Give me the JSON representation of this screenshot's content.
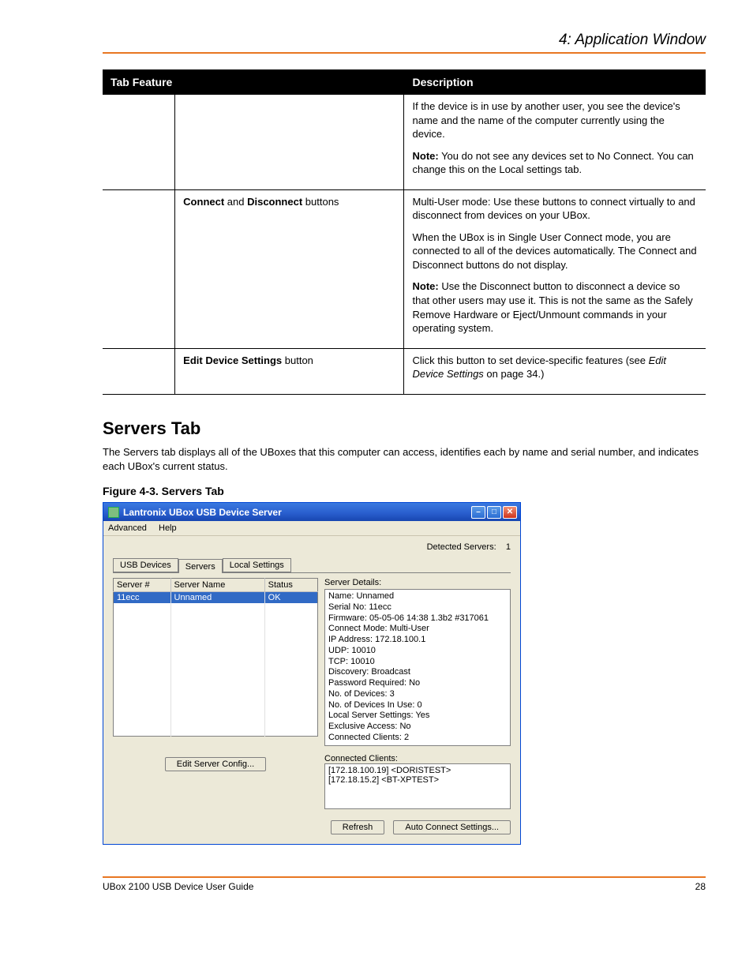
{
  "doc": {
    "header_right": "4: Application Window",
    "footer_left": "UBox 2100 USB Device User Guide",
    "footer_right": "28"
  },
  "table": {
    "h1": "Tab Feature",
    "h2": "Description",
    "rows": [
      {
        "c1": "",
        "c2_paras": [
          ""
        ],
        "c3_paras": [
          "If the device is in use by another user, you see the device's name and the name of the computer currently using the device.",
          "<strong>Note:</strong> You do not see any devices set to No Connect. You can change this on the Local settings tab."
        ]
      },
      {
        "c1": "",
        "c2_paras": [
          "<strong>Connect</strong> and <strong>Disconnect</strong> buttons"
        ],
        "c3_paras": [
          "Multi-User mode: Use these buttons to connect virtually to and disconnect from devices on your UBox.",
          "When the UBox is in Single User Connect mode, you are connected to all of the devices automatically. The Connect and Disconnect buttons do not display.",
          "<strong>Note:</strong> Use the Disconnect button to disconnect a device so that other users may use it. This is not the same as the Safely Remove Hardware or Eject/Unmount commands in your operating system."
        ]
      },
      {
        "c1": "",
        "c2_paras": [
          "<strong>Edit Device Settings</strong> button"
        ],
        "c3_paras": [
          "Click this button to set device-specific features (see <em>Edit Device Settings</em> on page 34.)"
        ]
      }
    ]
  },
  "section": {
    "title": "Servers Tab",
    "body": "The Servers tab displays all of the UBoxes that this computer can access, identifies each by name and serial number, and indicates each UBox's current status.",
    "figcap": "Figure 4-3. Servers Tab"
  },
  "win": {
    "title": "Lantronix UBox USB Device Server",
    "menu": {
      "advanced": "Advanced",
      "help": "Help"
    },
    "detected_label": "Detected Servers:",
    "detected_count": "1",
    "tabs": {
      "usb": "USB Devices",
      "servers": "Servers",
      "local": "Local Settings"
    },
    "cols": {
      "num": "Server #",
      "name": "Server Name",
      "status": "Status"
    },
    "rows": [
      {
        "num": "11ecc",
        "name": "Unnamed",
        "status": "OK"
      }
    ],
    "edit_btn": "Edit Server Config...",
    "details_label": "Server Details:",
    "details": {
      "Name": "Unnamed",
      "Serial_No": "11ecc",
      "Firmware": "05-05-06 14:38 1.3b2 #317061",
      "Connect_Mode": "Multi-User",
      "IP_Address": "172.18.100.1",
      "UDP": "10010",
      "TCP": "10010",
      "Discovery": "Broadcast",
      "Password_Required": "No",
      "No_of_Devices": "3",
      "No_of_Devices_In_Use": "0",
      "Local_Server_Settings": "Yes",
      "Exclusive_Access": "No",
      "Connected_Clients": "2"
    },
    "clients_label": "Connected Clients:",
    "clients": [
      "[172.18.100.19]  <DORISTEST>",
      "[172.18.15.2]  <BT-XPTEST>"
    ],
    "refresh": "Refresh",
    "auto": "Auto Connect Settings..."
  }
}
